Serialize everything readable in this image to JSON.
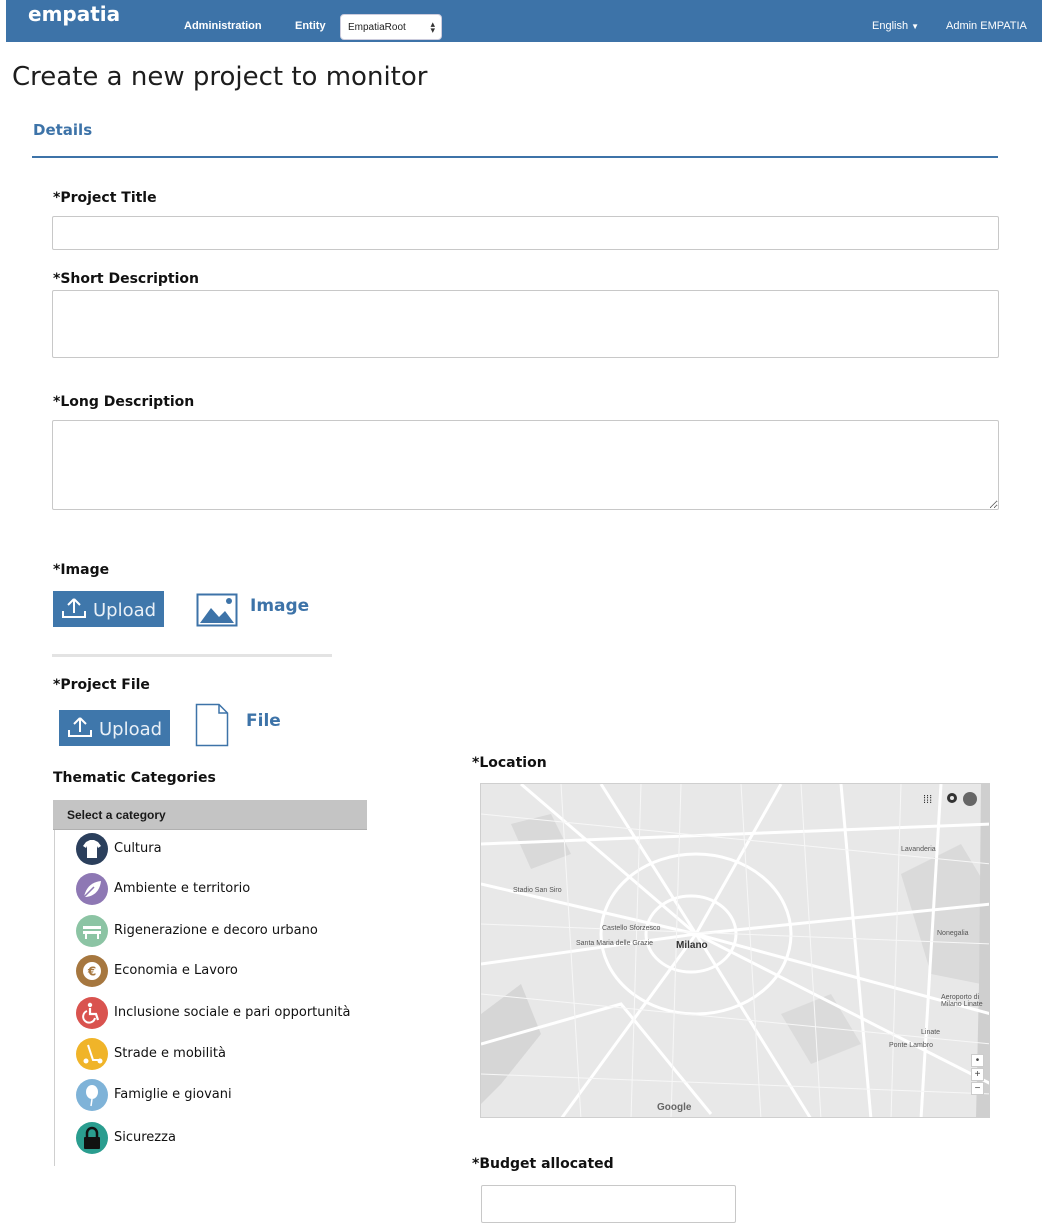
{
  "navbar": {
    "brand": "empatia",
    "administration": "Administration",
    "entity_label": "Entity",
    "entity_selected": "EmpatiaRoot",
    "language": "English",
    "user": "Admin EMPATIA",
    "color": "#3d73a8"
  },
  "page": {
    "title": "Create a new project to monitor",
    "tab": "Details"
  },
  "form": {
    "project_title_label": "*Project Title",
    "project_title_value": "",
    "short_description_label": "*Short Description",
    "short_description_value": "",
    "long_description_label": "*Long Description",
    "long_description_value": "",
    "image_label": "*Image",
    "image_upload_label": "Upload",
    "image_link_label": "Image",
    "file_label": "*Project File",
    "file_upload_label": "Upload",
    "file_link_label": "File",
    "location_label": "*Location",
    "budget_label": "*Budget allocated",
    "budget_value": ""
  },
  "categories": {
    "heading": "Thematic Categories",
    "select_placeholder": "Select a category",
    "items": [
      {
        "label": "Cultura",
        "icon": "tshirt-icon",
        "color": "#2b3f5c"
      },
      {
        "label": "Ambiente e territorio",
        "icon": "leaf-icon",
        "color": "#8e78b4"
      },
      {
        "label": "Rigenerazione e decoro urbano",
        "icon": "bench-icon",
        "color": "#8cc4a4"
      },
      {
        "label": "Economia e Lavoro",
        "icon": "euro-icon",
        "color": "#a6773f"
      },
      {
        "label": "Inclusione sociale e pari opportunità",
        "icon": "wheelchair-icon",
        "color": "#d9534f"
      },
      {
        "label": "Strade e mobilità",
        "icon": "scooter-icon",
        "color": "#f0b429"
      },
      {
        "label": "Famiglie e giovani",
        "icon": "balloon-icon",
        "color": "#7fb3d8"
      },
      {
        "label": "Sicurezza",
        "icon": "lock-icon",
        "color": "#2a9d8f"
      }
    ]
  },
  "map": {
    "city": "Milano",
    "labels": [
      "Castello Sforzesco",
      "Santa Maria delle Grazie",
      "Stadio San Siro",
      "Lavanderia",
      "Nonegalia",
      "Aeroporto di Milano Linate",
      "Linate",
      "Ponte Lambro"
    ],
    "attribution": "Google",
    "zoom_in": "+",
    "zoom_out": "−"
  }
}
